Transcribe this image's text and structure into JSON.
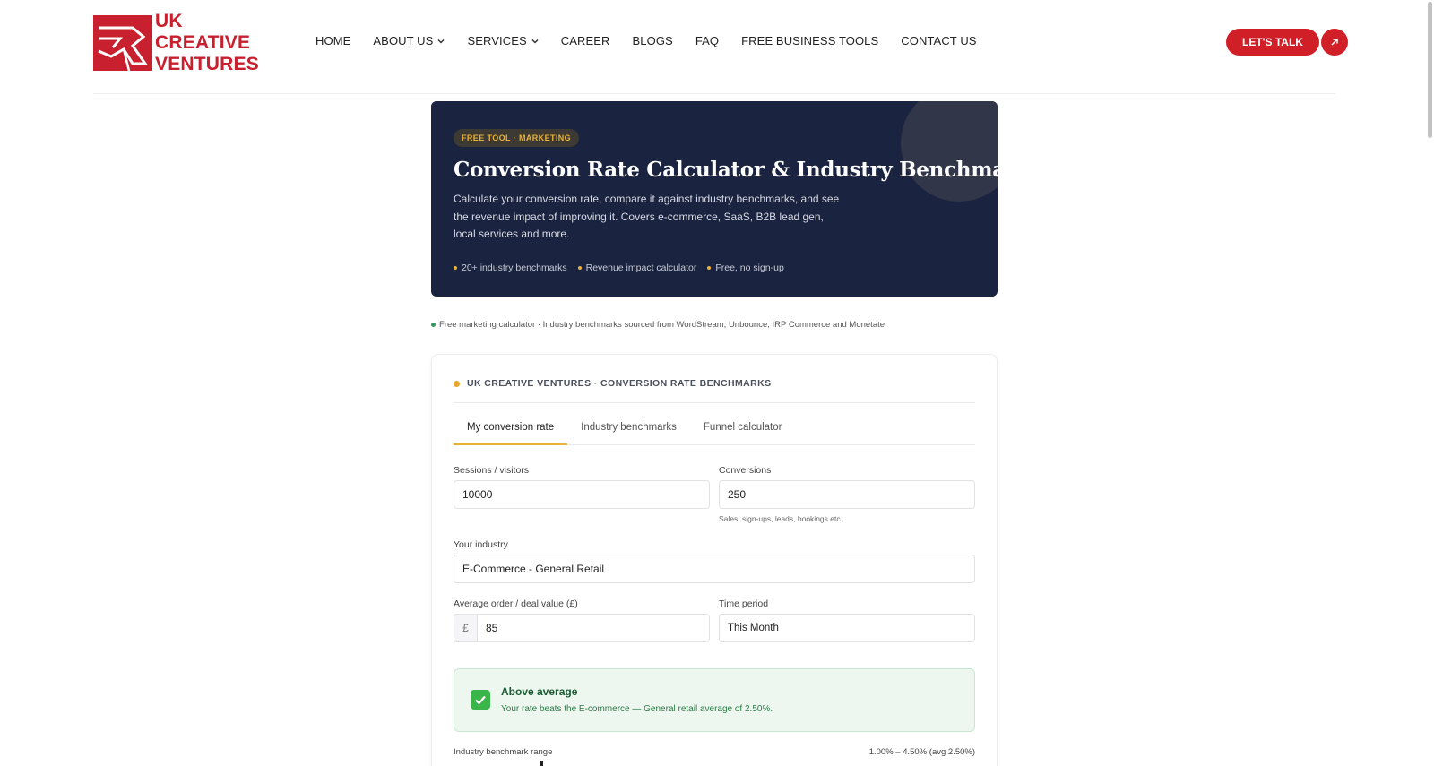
{
  "header": {
    "logo_lines": [
      "UK",
      "CREATIVE",
      "VENTURES"
    ],
    "nav": [
      {
        "label": "HOME",
        "dropdown": false
      },
      {
        "label": "ABOUT US",
        "dropdown": true
      },
      {
        "label": "SERVICES",
        "dropdown": true
      },
      {
        "label": "CAREER",
        "dropdown": false
      },
      {
        "label": "BLOGS",
        "dropdown": false
      },
      {
        "label": "FAQ",
        "dropdown": false
      },
      {
        "label": "FREE BUSINESS TOOLS",
        "dropdown": false
      },
      {
        "label": "CONTACT US",
        "dropdown": false
      }
    ],
    "cta_label": "LET'S TALK"
  },
  "hero": {
    "tag": "FREE TOOL · MARKETING",
    "title": "Conversion Rate Calculator & Industry Benchmarks",
    "description": "Calculate your conversion rate, compare it against industry benchmarks, and see the revenue impact of improving it. Covers e-commerce, SaaS, B2B lead gen, local services and more.",
    "bullets": [
      "20+ industry benchmarks",
      "Revenue impact calculator",
      "Free, no sign-up"
    ]
  },
  "notice": "Free marketing calculator · Industry benchmarks sourced from WordStream, Unbounce, IRP Commerce and Monetate",
  "card": {
    "heading": "UK CREATIVE VENTURES · CONVERSION RATE BENCHMARKS",
    "tabs": [
      "My conversion rate",
      "Industry benchmarks",
      "Funnel calculator"
    ],
    "sessions": {
      "label": "Sessions / visitors",
      "value": "10000"
    },
    "conversions": {
      "label": "Conversions",
      "value": "250",
      "hint": "Sales, sign-ups, leads, bookings etc."
    },
    "industry": {
      "label": "Your industry",
      "value": "E-Commerce - General Retail"
    },
    "order_value": {
      "label": "Average order / deal value (£)",
      "prefix": "£",
      "value": "85"
    },
    "period": {
      "label": "Time period",
      "value": "This Month"
    },
    "result": {
      "title": "Above average",
      "text": "Your rate beats the E-commerce — General retail average of 2.50%."
    },
    "benchmark": {
      "label": "Industry benchmark range",
      "value": "1.00% – 4.50% (avg 2.50%)"
    }
  },
  "colors": {
    "brand_red": "#c8202f",
    "hero_bg": "#1a2340",
    "accent_gold": "#e8b13a",
    "success_green": "#3ab54a"
  }
}
